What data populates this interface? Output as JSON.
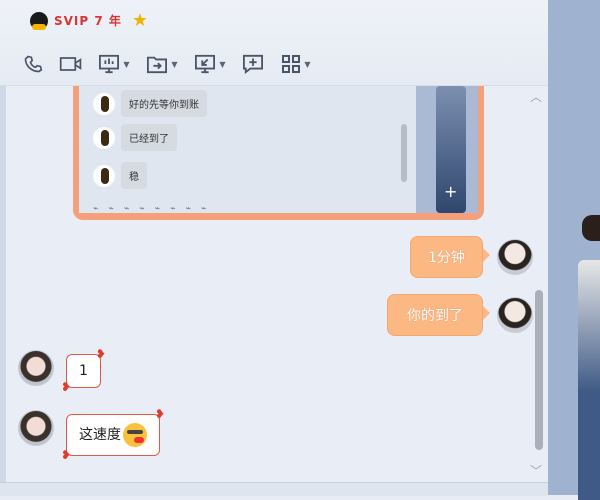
{
  "header": {
    "vip_label": "SVIP 7 年",
    "toolbar": [
      {
        "icon": "phone-icon"
      },
      {
        "icon": "video-icon"
      },
      {
        "icon": "screen-share-icon",
        "dropdown": true
      },
      {
        "icon": "file-transfer-icon",
        "dropdown": true
      },
      {
        "icon": "remote-desktop-icon",
        "dropdown": true
      },
      {
        "icon": "add-comment-icon"
      },
      {
        "icon": "apps-grid-icon",
        "dropdown": true
      }
    ]
  },
  "embedded_chat": {
    "messages": [
      {
        "text": "好的先等你到账"
      },
      {
        "text": "已经到了"
      },
      {
        "text": "稳"
      }
    ]
  },
  "messages": [
    {
      "side": "right",
      "text": "1分钟"
    },
    {
      "side": "right",
      "text": "你的到了"
    },
    {
      "side": "left",
      "text": "1"
    },
    {
      "side": "left",
      "text": "这速度"
    }
  ],
  "colors": {
    "bubble_right": "#fbb883",
    "bubble_left_border": "#e05a4a",
    "embedded_frame": "#f4a07a"
  }
}
